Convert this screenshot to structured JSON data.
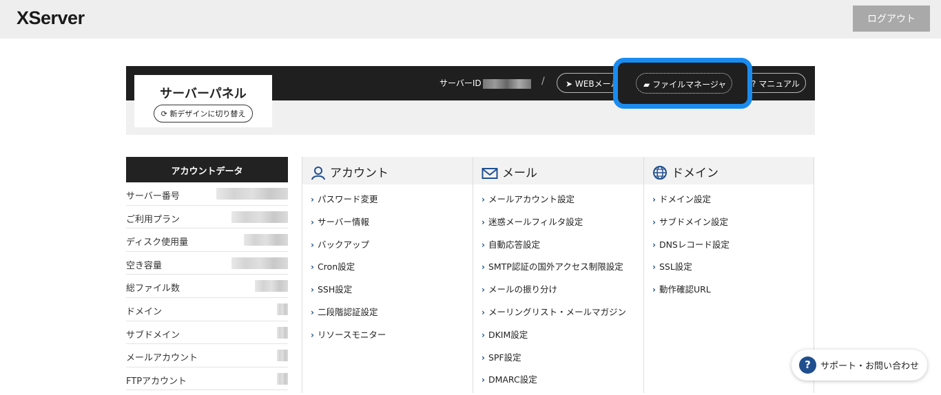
{
  "header": {
    "logo": "XServer",
    "logout_label": "ログアウト"
  },
  "panel": {
    "title": "サーバーパネル",
    "switch_design_label": "新デザインに切り替え",
    "server_id_label": "サーバーID",
    "separator": "/",
    "web_mail_label": "WEBメール",
    "file_manager_label": "ファイルマネージャ",
    "manual_label": "マニュアル"
  },
  "account_data": {
    "title": "アカウントデータ",
    "rows": [
      "サーバー番号",
      "ご利用プラン",
      "ディスク使用量",
      "空き容量",
      "総ファイル数",
      "ドメイン",
      "サブドメイン",
      "メールアカウント",
      "FTPアカウント"
    ]
  },
  "columns": [
    {
      "title": "アカウント",
      "icon": "user-icon",
      "items": [
        "パスワード変更",
        "サーバー情報",
        "バックアップ",
        "Cron設定",
        "SSH設定",
        "二段階認証設定",
        "リソースモニター"
      ]
    },
    {
      "title": "メール",
      "icon": "envelope-icon",
      "items": [
        "メールアカウント設定",
        "迷惑メールフィルタ設定",
        "自動応答設定",
        "SMTP認証の国外アクセス制限設定",
        "メールの振り分け",
        "メーリングリスト・メールマガジン",
        "DKIM設定",
        "SPF設定",
        "DMARC設定"
      ]
    },
    {
      "title": "ドメイン",
      "icon": "globe-icon",
      "items": [
        "ドメイン設定",
        "サブドメイン設定",
        "DNSレコード設定",
        "SSL設定",
        "動作確認URL"
      ]
    }
  ],
  "support_label": "サポート・お問い合わせ",
  "colors": {
    "accent_highlight": "#1a8cf0",
    "dark_bar": "#1f1f1f",
    "link_chevron": "#1a4f8a"
  }
}
